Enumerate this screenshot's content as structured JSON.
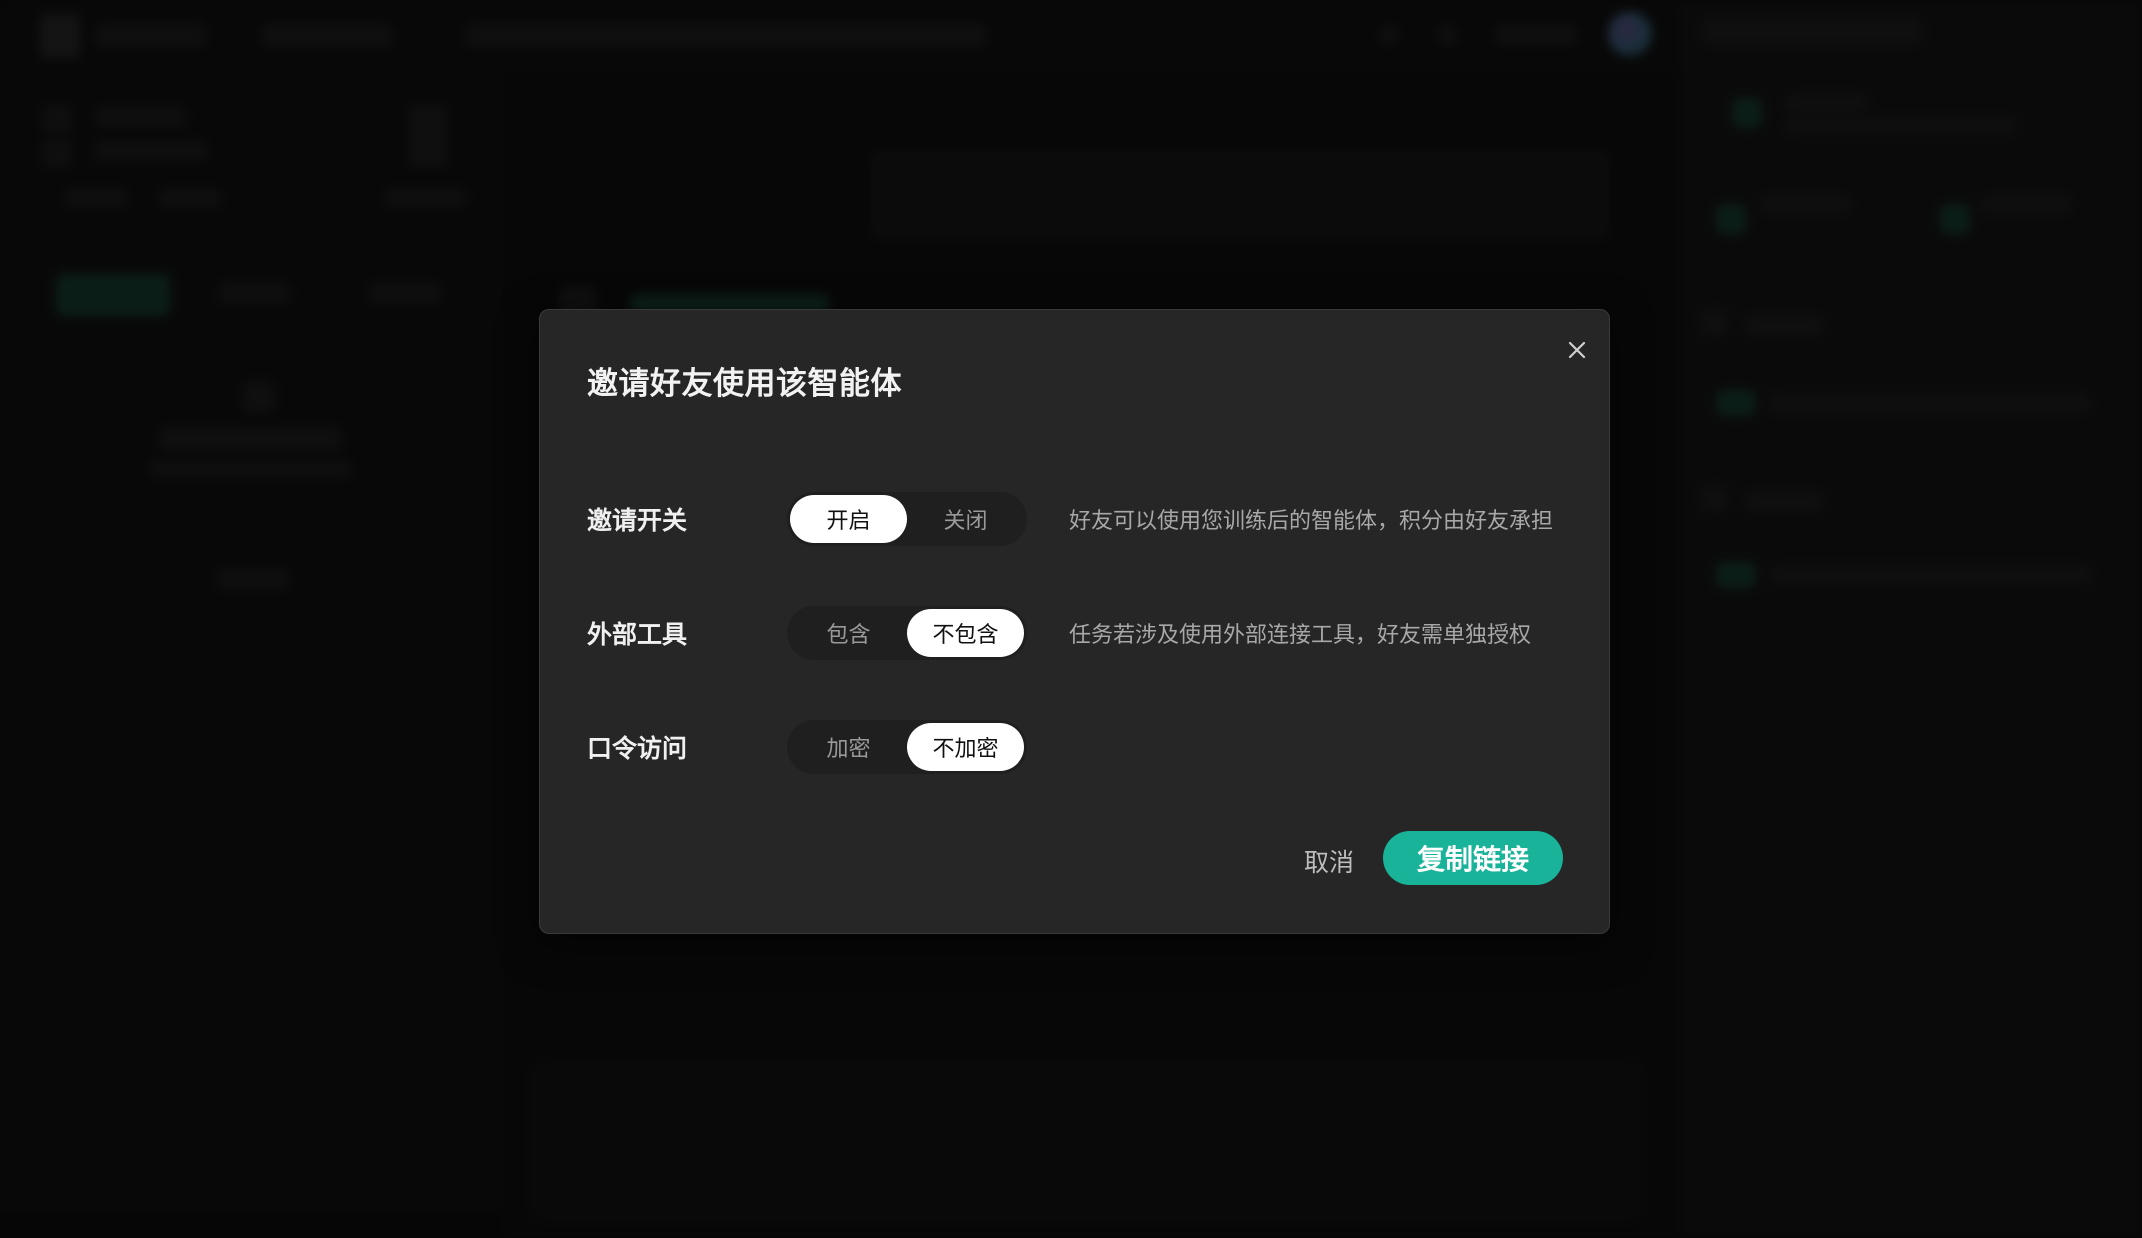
{
  "dialog": {
    "title": "邀请好友使用该智能体",
    "close_icon": "close-icon",
    "rows": [
      {
        "label": "邀请开关",
        "options": [
          "开启",
          "关闭"
        ],
        "selected": "开启",
        "description": "好友可以使用您训练后的智能体，积分由好友承担"
      },
      {
        "label": "外部工具",
        "options": [
          "包含",
          "不包含"
        ],
        "selected": "不包含",
        "description": "任务若涉及使用外部连接工具，好友需单独授权"
      },
      {
        "label": "口令访问",
        "options": [
          "加密",
          "不加密"
        ],
        "selected": "不加密",
        "description": ""
      }
    ],
    "cancel_label": "取消",
    "copy_label": "复制链接"
  },
  "colors": {
    "accent": "#19b39a",
    "dialog_bg": "#262626",
    "toggle_active": "#ffffff"
  }
}
